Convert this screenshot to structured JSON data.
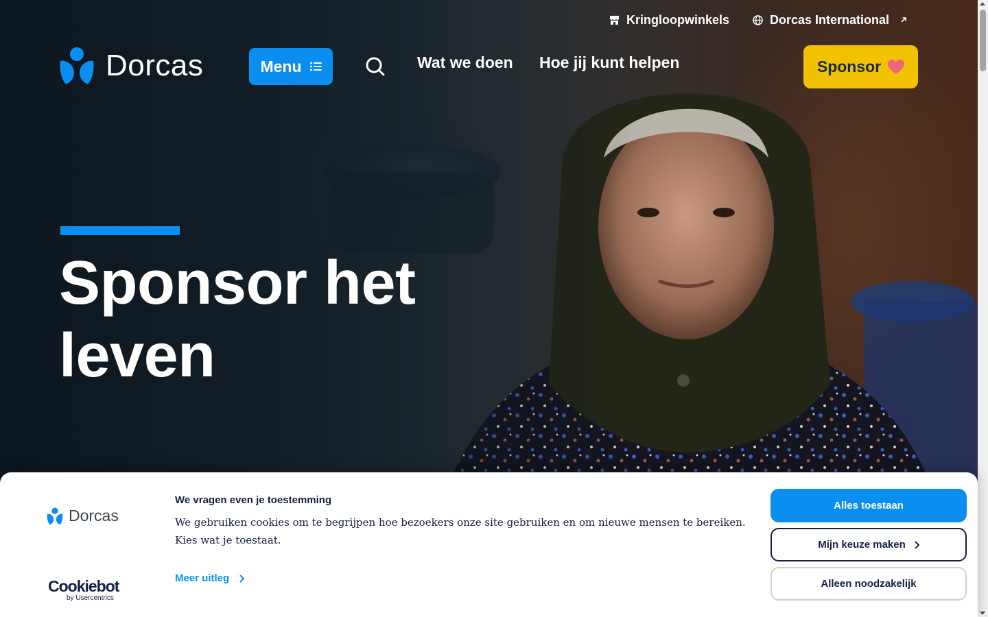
{
  "utility_nav": {
    "shops_label": "Kringloopwinkels",
    "international_label": "Dorcas International"
  },
  "header": {
    "logo_text": "Dorcas",
    "menu_label": "Menu",
    "nav": [
      "Wat we doen",
      "Hoe jij kunt helpen"
    ],
    "sponsor_label": "Sponsor"
  },
  "hero": {
    "title": "Sponsor het leven"
  },
  "cookie_banner": {
    "logo_text": "Dorcas",
    "title": "We vragen even je toestemming",
    "text": "We gebruiken cookies om te begrijpen hoe bezoekers onze site gebruiken en om nieuwe mensen te bereiken. Kies wat je toestaat.",
    "more_label": "Meer uitleg",
    "cookiebot_label": "Cookiebot",
    "cookiebot_sub": "by Usercentrics",
    "buttons": {
      "allow_all": "Alles toestaan",
      "customize": "Mijn keuze maken",
      "necessary": "Alleen noodzakelijk"
    }
  },
  "colors": {
    "brand_blue": "#0a8ff0",
    "sponsor_yellow": "#f2c200",
    "heart_pink": "#f0637a",
    "navy_text": "#141e46"
  },
  "icons": [
    "store-icon",
    "globe-icon",
    "external-arrow-icon",
    "dorcas-logo-icon",
    "list-icon",
    "search-icon",
    "heart-icon",
    "chevron-right-icon"
  ]
}
